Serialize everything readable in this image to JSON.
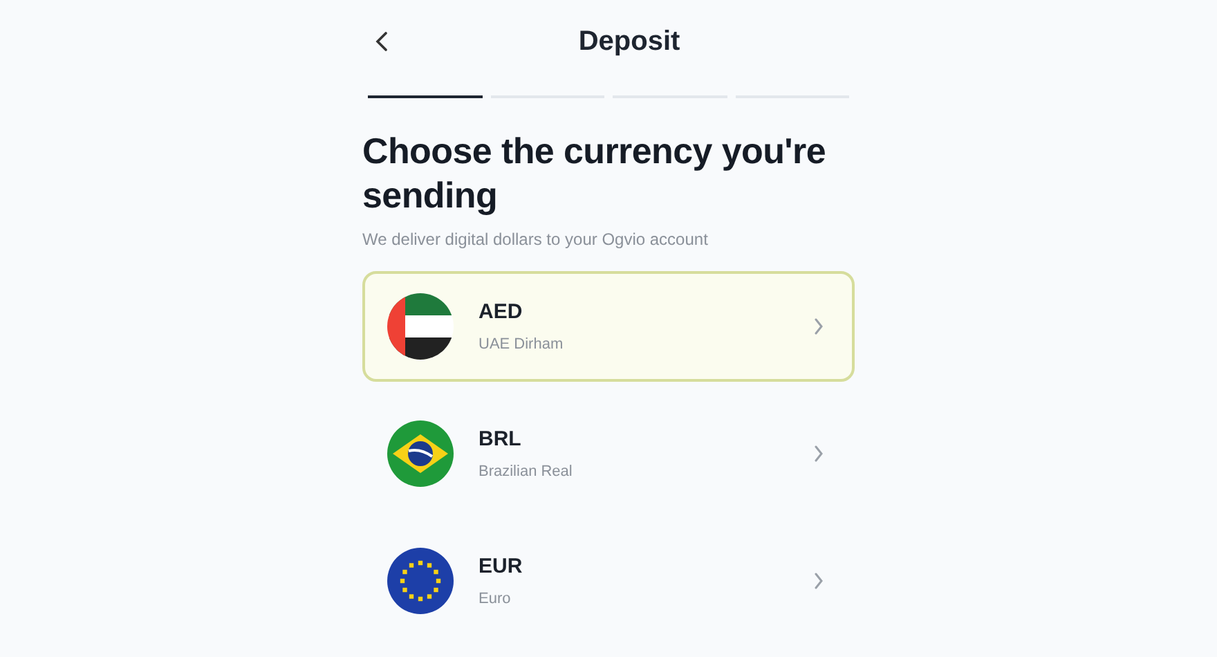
{
  "header": {
    "title": "Deposit"
  },
  "progress_steps": [
    {
      "active": true
    },
    {
      "active": false
    },
    {
      "active": false
    },
    {
      "active": false
    }
  ],
  "heading": "Choose the currency you're sending",
  "subtitle": "We deliver digital dollars to your Ogvio account",
  "currencies": [
    {
      "code": "AED",
      "name": "UAE Dirham",
      "kind": "ae",
      "selected": true
    },
    {
      "code": "BRL",
      "name": "Brazilian Real",
      "kind": "br",
      "selected": false
    },
    {
      "code": "EUR",
      "name": "Euro",
      "kind": "eu",
      "selected": false
    }
  ]
}
